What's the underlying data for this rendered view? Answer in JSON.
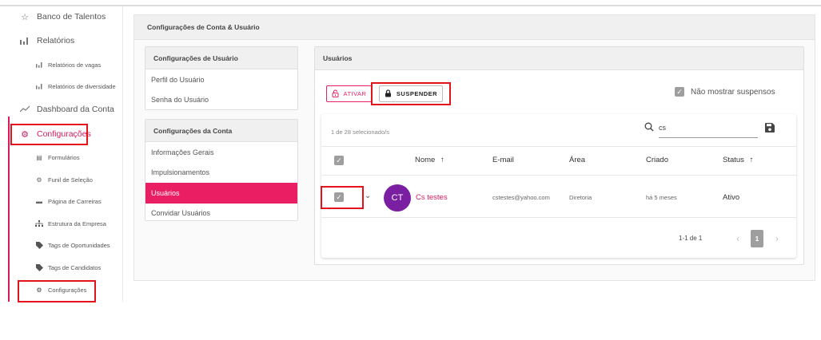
{
  "sidebar": {
    "banco_talentos": "Banco de Talentos",
    "relatorios": "Relatórios",
    "relatorios_vagas": "Relatórios de vagas",
    "relatorios_diversidade": "Relatórios de diversidade",
    "dashboard": "Dashboard da Conta",
    "configuracoes": "Configurações",
    "formularios": "Formulários",
    "funil": "Funil de Seleção",
    "pagina_carreiras": "Página de Carreiras",
    "estrutura": "Estrutura da Empresa",
    "tags_oportunidades": "Tags de Oportunidades",
    "tags_candidatos": "Tags de Candidatos",
    "configuracoes_sub": "Configurações"
  },
  "main": {
    "title": "Configurações de Conta & Usuário"
  },
  "user_settings": {
    "header": "Configurações de Usuário",
    "items": [
      "Perfil do Usuário",
      "Senha do Usuário"
    ]
  },
  "account_settings": {
    "header": "Configurações da Conta",
    "items": [
      "Informações Gerais",
      "Impulsionamentos",
      "Usuários",
      "Convidar Usuários"
    ],
    "active": "Usuários"
  },
  "users": {
    "header": "Usuários",
    "ativar_label": "ATIVAR",
    "suspender_label": "SUSPENDER",
    "hide_suspended_label": "Não mostrar suspensos",
    "selected_count": "1 de 28 selecionado/s",
    "search_value": "cs",
    "columns": {
      "nome": "Nome",
      "email": "E-mail",
      "area": "Área",
      "criado": "Criado",
      "status": "Status"
    },
    "rows": [
      {
        "initials": "CT",
        "nome": "Cs testes",
        "email": "cstestes@yahoo.com",
        "area": "Diretoria",
        "criado": "há 5 meses",
        "status": "Ativo"
      }
    ],
    "pagination": {
      "range": "1-1 de 1",
      "page": "1"
    }
  },
  "colors": {
    "accent": "#e91e63",
    "highlight": "#e5121b",
    "avatar": "#7b1fa2",
    "checkbox": "#9e9e9e"
  }
}
